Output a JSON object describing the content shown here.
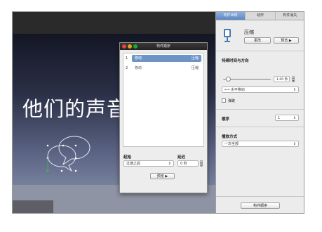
{
  "build_order_panel": {
    "title": "构件顺序",
    "items": [
      {
        "num": "1",
        "name": "移动",
        "type": "压缩",
        "selected": true
      },
      {
        "num": "2",
        "name": "移动",
        "type": "压缩",
        "selected": false
      }
    ],
    "start_label": "起始",
    "start_value": "过渡之后",
    "delay_label": "延迟",
    "delay_value": "0 秒",
    "preview_label": "预览 ▶"
  },
  "slide": {
    "title": "他们的声音"
  },
  "inspector": {
    "tabs": [
      {
        "label": "构件出现",
        "active": true
      },
      {
        "label": "动作",
        "active": false
      },
      {
        "label": "构件消失",
        "active": false
      }
    ],
    "effect_name": "压缩",
    "change_label": "更改",
    "preview_label": "预览 ▶",
    "duration_direction_label": "持续时间与方向",
    "duration_value": "1.00 秒",
    "duration_fraction": 0.1,
    "direction_value": "⟷ 水平移动",
    "bounce_label": "弹跳",
    "order_label": "顺序",
    "order_value": "1",
    "delivery_label": "播放方式",
    "delivery_value": "一次全部",
    "build_order_button": "构件顺序"
  },
  "colors": {
    "selection": "#6d93c7",
    "tab_active": "#5e86c1",
    "handle_green": "#3fb54a"
  }
}
